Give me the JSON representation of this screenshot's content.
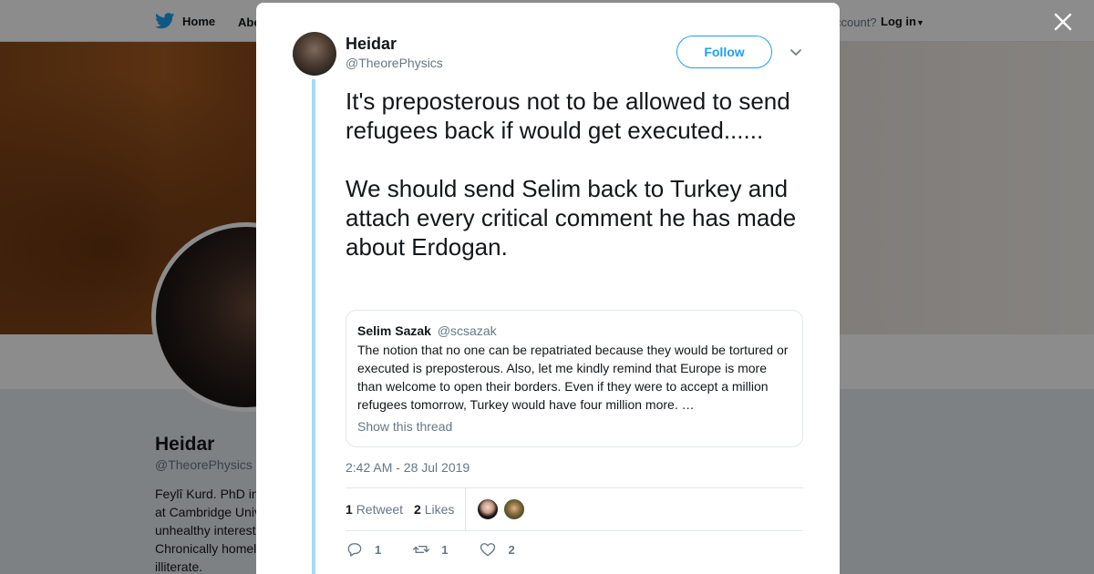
{
  "topbar": {
    "home_label": "Home",
    "about_label": "Abo",
    "account_text": "ccount?",
    "login_label": "Log in"
  },
  "profile": {
    "name": "Heidar",
    "handle": "@TheorePhysics",
    "bio_lines": [
      "Feylî Kurd. PhD in",
      "at Cambridge Univ",
      "unhealthy interest",
      "Chronically homel",
      "illiterate."
    ]
  },
  "tweet": {
    "author_name": "Heidar",
    "author_handle": "@TheorePhysics",
    "follow_label": "Follow",
    "paragraphs": [
      "It's preposterous not to be allowed to send refugees back if would get executed......",
      "We should send Selim back to Turkey and attach every critical comment he has made about Erdogan."
    ],
    "quote": {
      "name": "Selim Sazak",
      "handle": "@scsazak",
      "text": "The notion that no one can be repatriated because they would be tortured or executed is preposterous. Also, let me kindly remind that Europe is more than welcome to open their borders. Even if they were to accept a million refugees tomorrow, Turkey would have four million more. …",
      "show_thread": "Show this thread"
    },
    "timestamp": "2:42 AM - 28 Jul 2019",
    "stats": {
      "retweet_count": "1",
      "retweet_label": "Retweet",
      "like_count": "2",
      "like_label": "Likes"
    },
    "actions": {
      "reply_count": "1",
      "retweet_count": "1",
      "like_count": "2"
    }
  },
  "colors": {
    "accent": "#1da1f2",
    "thread_line": "#a6d9f7",
    "muted_text": "#657786"
  }
}
